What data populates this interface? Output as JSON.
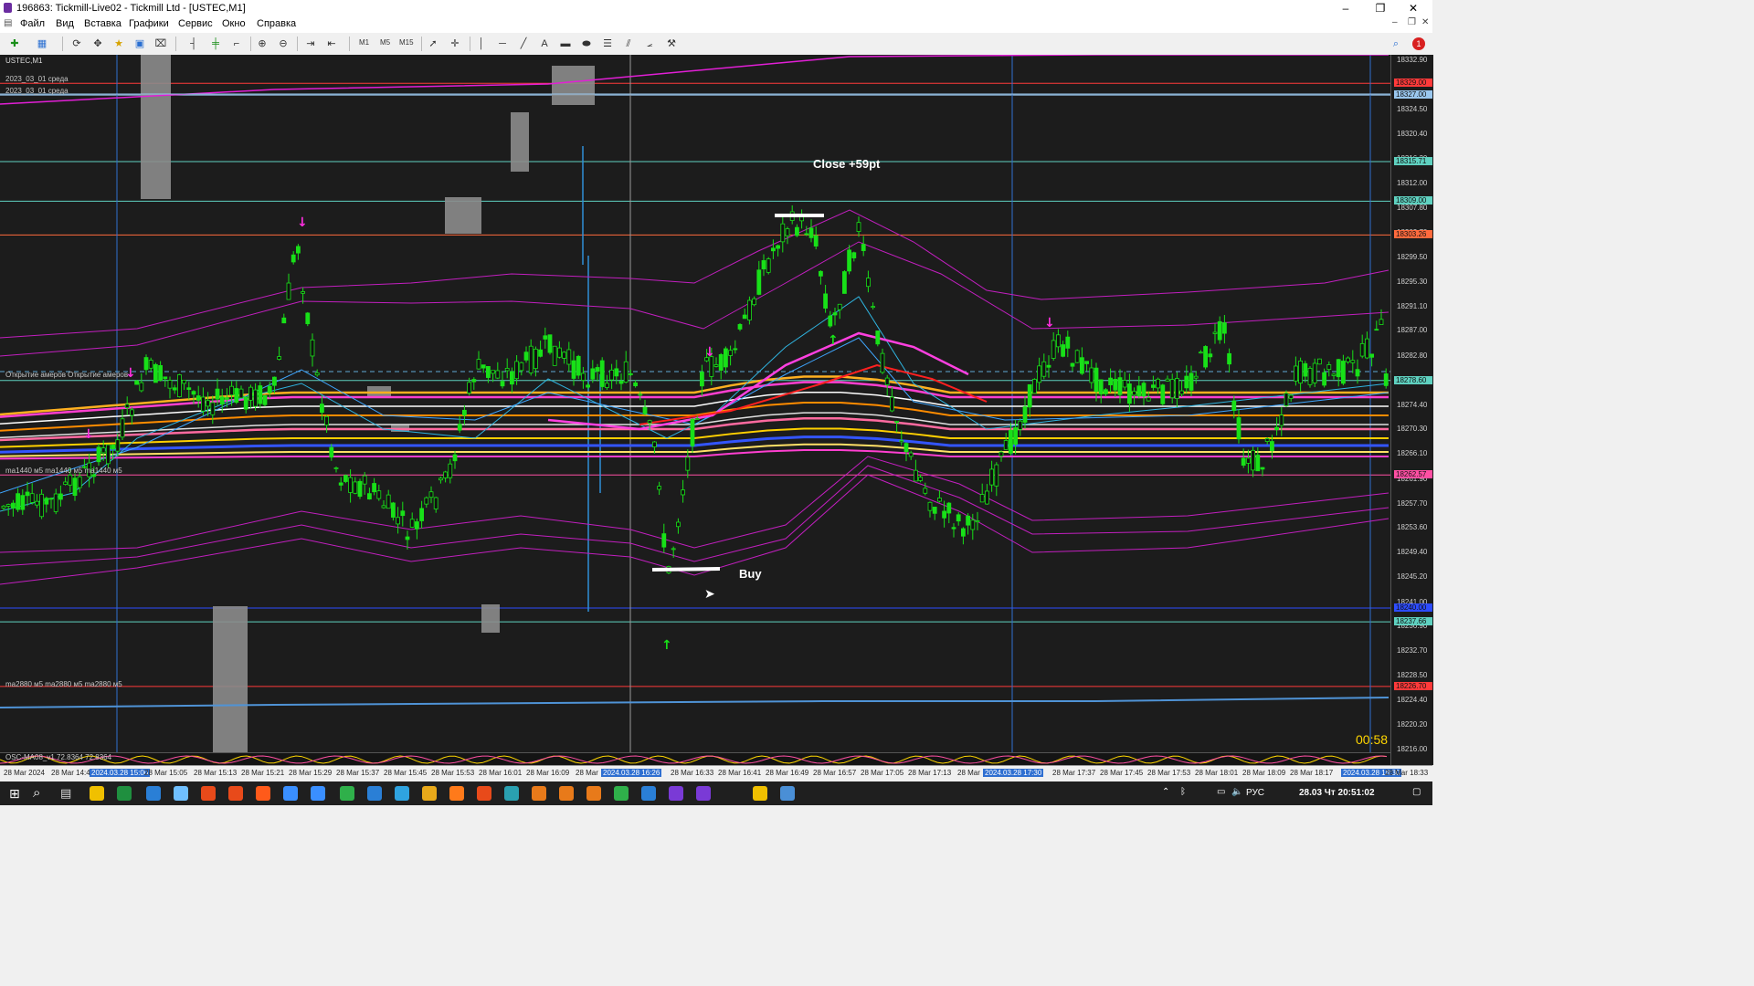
{
  "window": {
    "title": "196863: Tickmill-Live02 - Tickmill Ltd - [USTEC,M1]",
    "minimize": "–",
    "restore": "❐",
    "close": "✕"
  },
  "menu": [
    "Файл",
    "Вид",
    "Вставка",
    "Графики",
    "Сервис",
    "Окно",
    "Справка"
  ],
  "toolbar": {
    "timeframes": [
      "M1",
      "M5",
      "M15"
    ],
    "icons": [
      "new-chart-icon",
      "profiles-icon",
      "market-watch-icon",
      "navigator-icon",
      "data-window-icon",
      "strategy-tester-icon",
      "bar-chart-icon",
      "candlestick-icon",
      "line-chart-icon",
      "zoom-in-icon",
      "zoom-out-icon",
      "autoscroll-icon",
      "chart-shift-icon",
      "cursor-icon",
      "crosshair-icon",
      "vertical-line-icon",
      "horizontal-line-icon",
      "trendline-icon",
      "text-icon",
      "rectangle-icon",
      "ellipse-icon",
      "fibo-icon",
      "channel-icon",
      "shapes-icon",
      "search-icon",
      "notification-icon"
    ]
  },
  "chart": {
    "symbol": "USTEC,M1",
    "labels": [
      "2023_03_01 среда",
      "2023_03_01 среда",
      "Открытие амеров   Открытие амеров",
      "ma1440 м5 ma1440 м5 ma1440 м5",
      "ma2880 м5 ma2880 м5 ma2880 м5"
    ],
    "annotation_close": "Close +59pt",
    "annotation_buy": "Buy",
    "timer": "00:58",
    "indicator_label": "OSC-MA08_v1 72.8364 72.8364"
  },
  "price_axis": {
    "ticks": [
      "18332.90",
      "18328.70",
      "18324.50",
      "18320.40",
      "18316.20",
      "18312.00",
      "18307.80",
      "18303.70",
      "18299.50",
      "18295.30",
      "18291.10",
      "18287.00",
      "18282.80",
      "18278.60",
      "18274.40",
      "18270.30",
      "18266.10",
      "18261.90",
      "18257.70",
      "18253.60",
      "18249.40",
      "18245.20",
      "18241.00",
      "18236.90",
      "18232.70",
      "18228.50",
      "18224.40",
      "18220.20",
      "18216.00"
    ],
    "boxes": [
      {
        "v": "18329.00",
        "color": "#ff3a3a"
      },
      {
        "v": "18327.00",
        "color": "#9ac7ee"
      },
      {
        "v": "18315.71",
        "color": "#5fd1c0"
      },
      {
        "v": "18309.00",
        "color": "#5fd1c0"
      },
      {
        "v": "18303.26",
        "color": "#ff6a3d"
      },
      {
        "v": "18278.60",
        "color": "#5fd1c0"
      },
      {
        "v": "18262.57",
        "color": "#ff4fa3"
      },
      {
        "v": "18240.00",
        "color": "#2d4cff"
      },
      {
        "v": "18237.66",
        "color": "#5fd1c0"
      },
      {
        "v": "18226.70",
        "color": "#ff3a3a"
      }
    ]
  },
  "time_axis": [
    {
      "t": "28 Mar 2024",
      "hl": false
    },
    {
      "t": "28 Mar 14:4",
      "hl": false
    },
    {
      "t": "2024.03.28 15:00",
      "hl": true
    },
    {
      "t": "28 Mar 15:05",
      "hl": false
    },
    {
      "t": "28 Mar 15:13",
      "hl": false
    },
    {
      "t": "28 Mar 15:21",
      "hl": false
    },
    {
      "t": "28 Mar 15:29",
      "hl": false
    },
    {
      "t": "28 Mar 15:37",
      "hl": false
    },
    {
      "t": "28 Mar 15:45",
      "hl": false
    },
    {
      "t": "28 Mar 15:53",
      "hl": false
    },
    {
      "t": "28 Mar 16:01",
      "hl": false
    },
    {
      "t": "28 Mar 16:09",
      "hl": false
    },
    {
      "t": "28 Mar",
      "hl": false
    },
    {
      "t": "2024.03.28 16:26",
      "hl": true
    },
    {
      "t": "28 Mar 16:33",
      "hl": false
    },
    {
      "t": "28 Mar 16:41",
      "hl": false
    },
    {
      "t": "28 Mar 16:49",
      "hl": false
    },
    {
      "t": "28 Mar 16:57",
      "hl": false
    },
    {
      "t": "28 Mar 17:05",
      "hl": false
    },
    {
      "t": "28 Mar 17:13",
      "hl": false
    },
    {
      "t": "28 Mar",
      "hl": false
    },
    {
      "t": "2024.03.28 17:30",
      "hl": true
    },
    {
      "t": "28 Mar 17:37",
      "hl": false
    },
    {
      "t": "28 Mar 17:45",
      "hl": false
    },
    {
      "t": "28 Mar 17:53",
      "hl": false
    },
    {
      "t": "28 Mar 18:01",
      "hl": false
    },
    {
      "t": "28 Mar 18:09",
      "hl": false
    },
    {
      "t": "28 Mar 18:17",
      "hl": false
    },
    {
      "t": "2024.03.28 18:30",
      "hl": true
    },
    {
      "t": "28 Mar 18:33",
      "hl": false
    }
  ],
  "taskbar": {
    "lang": "РУС",
    "clock": "28.03 Чт 20:51:02",
    "apps": [
      "start-icon",
      "search-icon",
      "task-view-icon",
      "file-explorer-icon",
      "excel-icon",
      "edge-icon",
      "notepad-icon",
      "brave-icon",
      "brave-icon",
      "mt-icon",
      "arrow-app-icon",
      "arrow-app-icon",
      "chart-app-icon",
      "terminal-icon",
      "telegram-icon",
      "chrome-icon",
      "firefox-icon",
      "brave-icon",
      "app-icon",
      "a-app-icon",
      "a-app-icon",
      "a-app-icon",
      "chart-app-icon",
      "chart-app-icon",
      "mt5-icon",
      "mt5-icon",
      "folder-icon",
      "settings-icon"
    ]
  },
  "colors": {
    "chart_bg": "#1c1c1c",
    "bull": "#18e018",
    "magenta": "#e21fd6",
    "accent_blue": "#2f6fd1"
  }
}
